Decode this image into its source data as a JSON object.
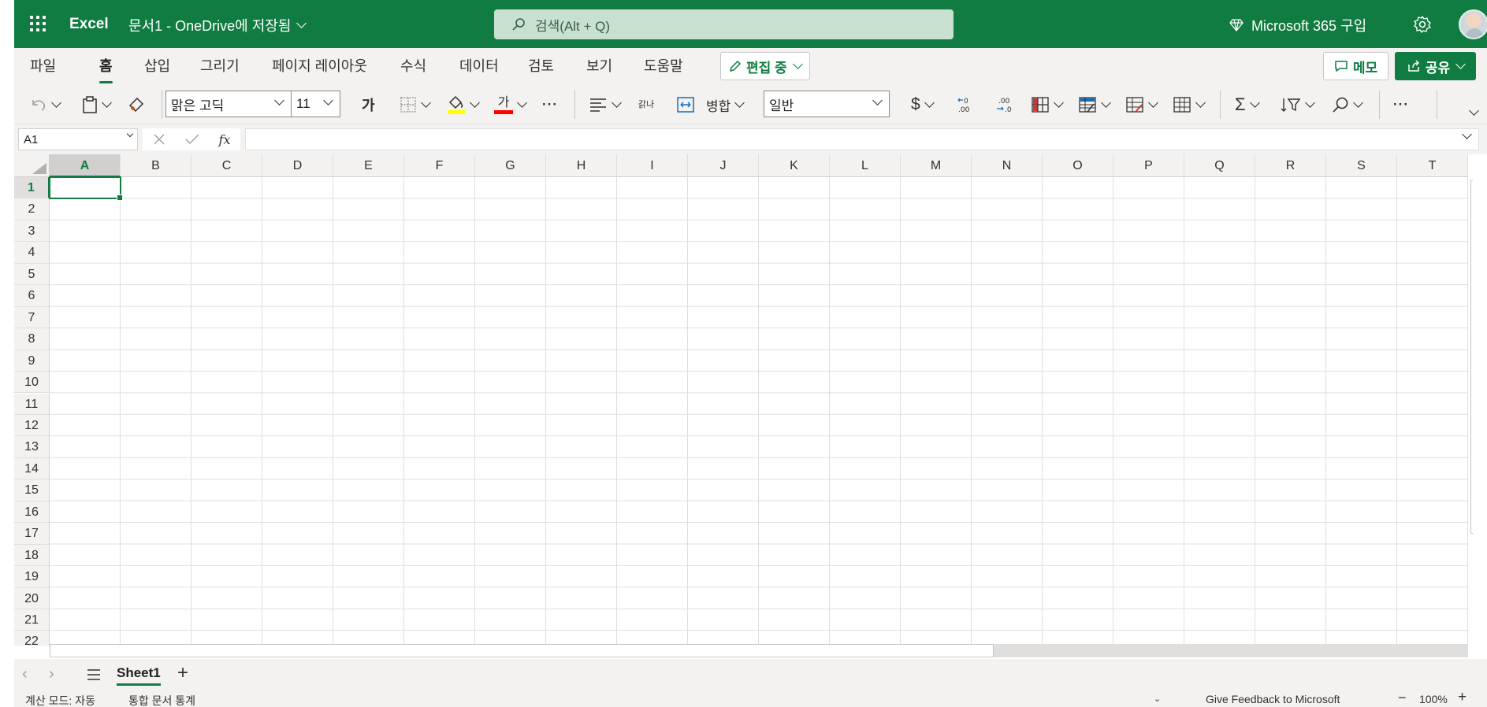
{
  "titlebar": {
    "app_name": "Excel",
    "doc_title": "문서1 - OneDrive에 저장됨",
    "search_placeholder": "검색(Alt + Q)",
    "upgrade_label": "Microsoft 365 구입"
  },
  "ribbon": {
    "tabs": [
      "파일",
      "홈",
      "삽입",
      "그리기",
      "페이지 레이아웃",
      "수식",
      "데이터",
      "검토",
      "보기",
      "도움말"
    ],
    "active_tab": "홈",
    "edit_mode_label": "편집 중",
    "memo_label": "메모",
    "share_label": "공유"
  },
  "toolbar": {
    "font_name": "맑은 고딕",
    "font_size": "11",
    "bold_glyph": "가",
    "font_color_glyph": "가",
    "wrap_glyph": "갉나",
    "merge_label": "병합",
    "number_format": "일반",
    "currency_glyph": "$",
    "sum_glyph": "Σ",
    "more_glyph": "···"
  },
  "formula_bar": {
    "name_box": "A1",
    "fx_label": "fx",
    "formula": ""
  },
  "grid": {
    "columns": [
      "A",
      "B",
      "C",
      "D",
      "E",
      "F",
      "G",
      "H",
      "I",
      "J",
      "K",
      "L",
      "M",
      "N",
      "O",
      "P",
      "Q",
      "R",
      "S",
      "T"
    ],
    "rows": [
      "1",
      "2",
      "3",
      "4",
      "5",
      "6",
      "7",
      "8",
      "9",
      "10",
      "11",
      "12",
      "13",
      "14",
      "15",
      "16",
      "17",
      "18",
      "19",
      "20",
      "21",
      "22"
    ],
    "selected_cell": "A1"
  },
  "sheets": {
    "tabs": [
      "Sheet1"
    ],
    "active": "Sheet1"
  },
  "statusbar": {
    "calc_mode": "계산 모드: 자동",
    "workbook_stats": "통합 문서 통계",
    "feedback": "Give Feedback to Microsoft",
    "zoom": "100%"
  },
  "colors": {
    "brand": "#107c41",
    "highlight_yellow": "#ffff00",
    "font_red": "#ff0000"
  }
}
